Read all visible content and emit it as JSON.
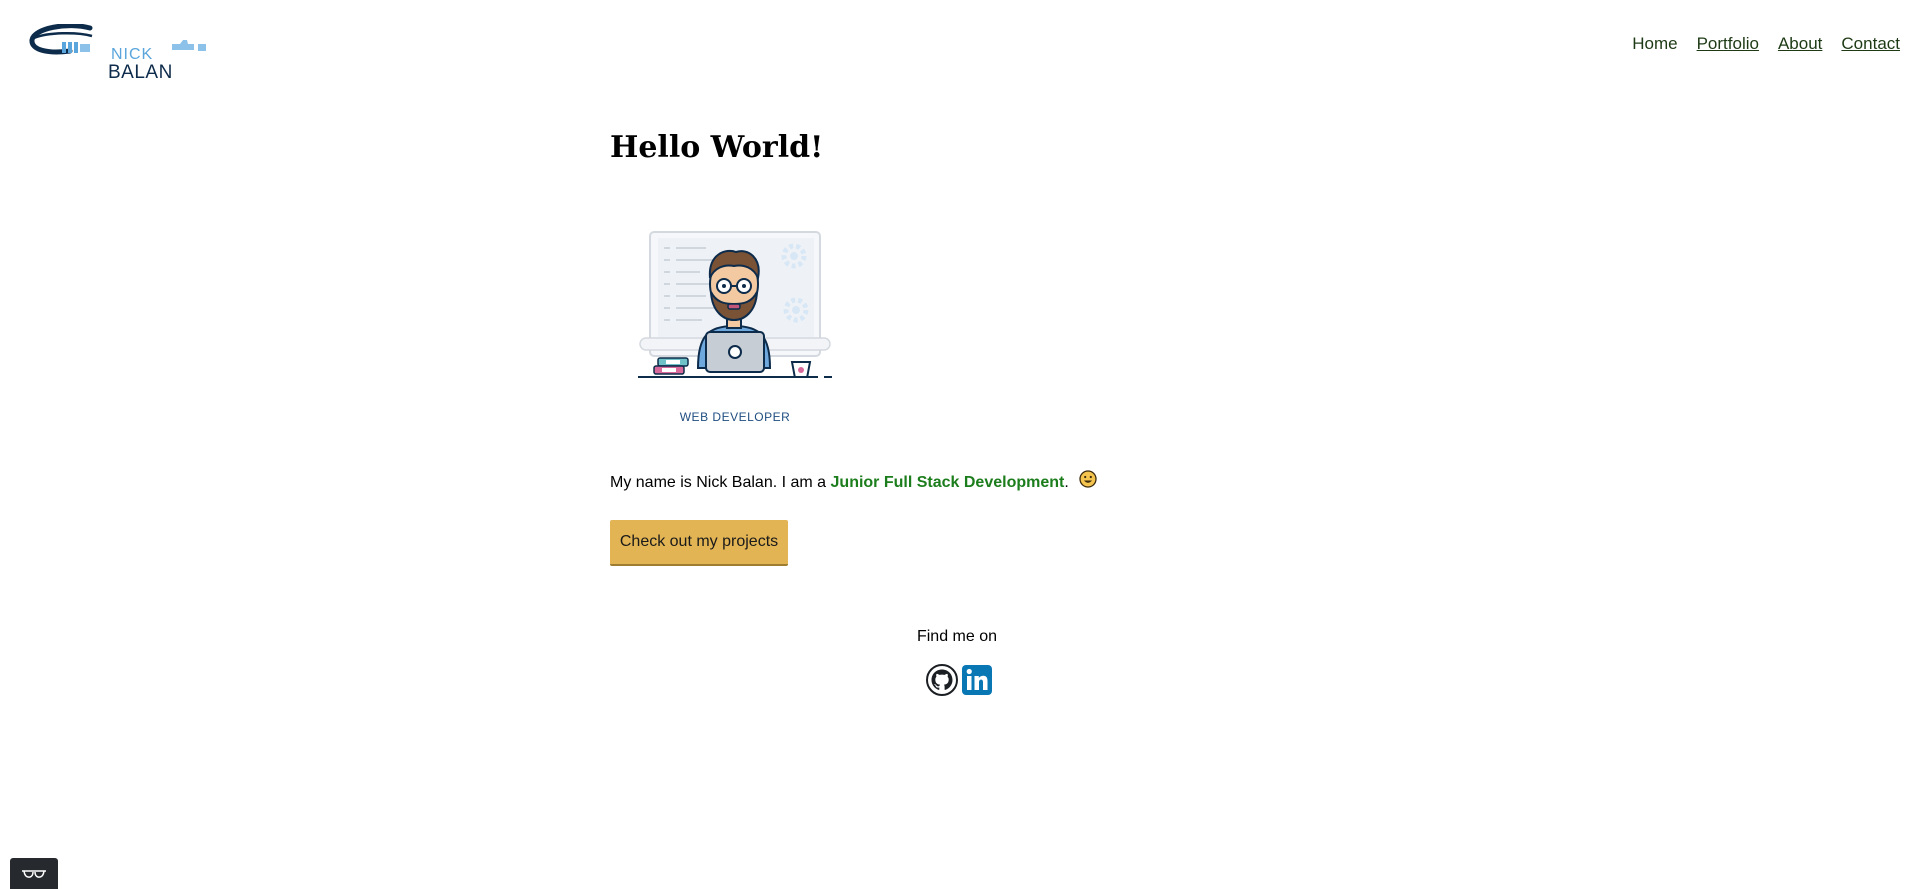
{
  "brand": {
    "first": "NICK",
    "last": "BALAN"
  },
  "nav": [
    {
      "label": "Home"
    },
    {
      "label": "Portfolio"
    },
    {
      "label": "About"
    },
    {
      "label": "Contact"
    }
  ],
  "hero": {
    "heading": "Hello World!",
    "illustration_icon": "web-developer-illustration",
    "caption": "WEB DEVELOPER"
  },
  "intro": {
    "prefix": "My name is Nick Balan. I am a ",
    "role": "Junior Full Stack Development",
    "suffix": ".",
    "emoji": "smiling-face-icon"
  },
  "cta": {
    "label": "Check out my projects"
  },
  "social": {
    "heading": "Find me on",
    "icons": [
      "github-icon",
      "linkedin-icon"
    ]
  },
  "colors": {
    "nav_text": "#1d3a14",
    "role_text": "#1c7d1c",
    "button_bg": "#e2b454",
    "linkedin": "#0a77b5",
    "logo_dark": "#0d2b4a",
    "logo_light": "#5aa6dc"
  }
}
